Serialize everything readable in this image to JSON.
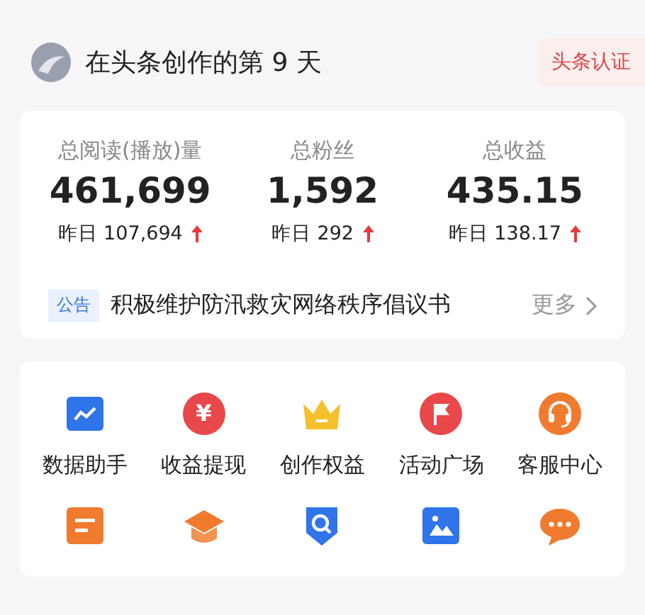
{
  "header": {
    "title": "在头条创作的第 9 天",
    "badge": "头条认证"
  },
  "stats": [
    {
      "label": "总阅读(播放)量",
      "value": "461,699",
      "yesterday": "昨日 107,694",
      "rising": true
    },
    {
      "label": "总粉丝",
      "value": "1,592",
      "yesterday": "昨日 292",
      "rising": true
    },
    {
      "label": "总收益",
      "value": "435.15",
      "yesterday": "昨日 138.17",
      "rising": true
    }
  ],
  "notice": {
    "tag": "公告",
    "text": "积极维护防汛救灾网络秩序倡议书",
    "more": "更多"
  },
  "tools": [
    {
      "kind": "chart",
      "label": "数据助手"
    },
    {
      "kind": "yen",
      "label": "收益提现",
      "glyph": "¥"
    },
    {
      "kind": "crown",
      "label": "创作权益"
    },
    {
      "kind": "flag",
      "label": "活动广场"
    },
    {
      "kind": "headset",
      "label": "客服中心"
    },
    {
      "kind": "draft"
    },
    {
      "kind": "cap"
    },
    {
      "kind": "shield"
    },
    {
      "kind": "image"
    },
    {
      "kind": "chat"
    }
  ]
}
